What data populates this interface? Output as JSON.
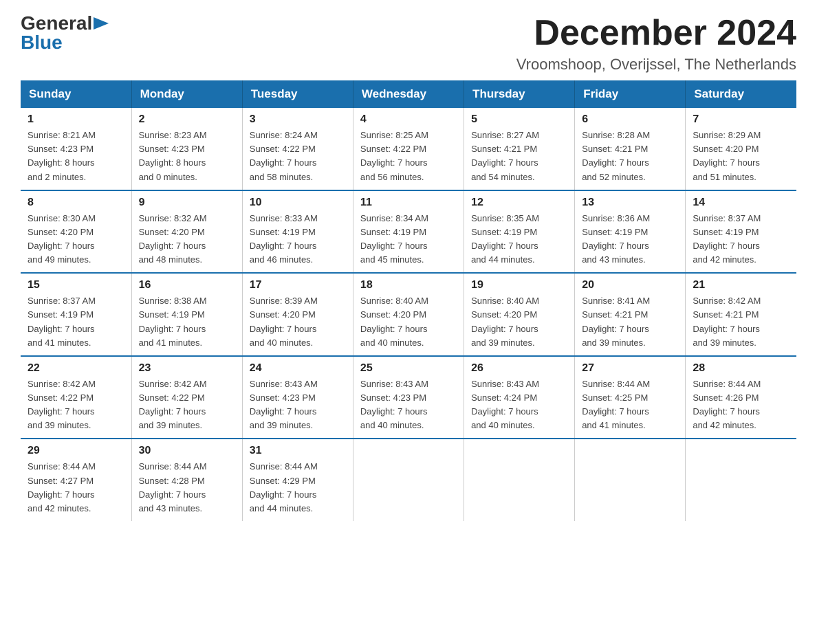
{
  "logo": {
    "general": "General",
    "blue": "Blue",
    "arrow": "▶"
  },
  "title": "December 2024",
  "location": "Vroomshoop, Overijssel, The Netherlands",
  "days_of_week": [
    "Sunday",
    "Monday",
    "Tuesday",
    "Wednesday",
    "Thursday",
    "Friday",
    "Saturday"
  ],
  "weeks": [
    [
      {
        "day": "1",
        "sunrise": "8:21 AM",
        "sunset": "4:23 PM",
        "daylight": "8 hours and 2 minutes."
      },
      {
        "day": "2",
        "sunrise": "8:23 AM",
        "sunset": "4:23 PM",
        "daylight": "8 hours and 0 minutes."
      },
      {
        "day": "3",
        "sunrise": "8:24 AM",
        "sunset": "4:22 PM",
        "daylight": "7 hours and 58 minutes."
      },
      {
        "day": "4",
        "sunrise": "8:25 AM",
        "sunset": "4:22 PM",
        "daylight": "7 hours and 56 minutes."
      },
      {
        "day": "5",
        "sunrise": "8:27 AM",
        "sunset": "4:21 PM",
        "daylight": "7 hours and 54 minutes."
      },
      {
        "day": "6",
        "sunrise": "8:28 AM",
        "sunset": "4:21 PM",
        "daylight": "7 hours and 52 minutes."
      },
      {
        "day": "7",
        "sunrise": "8:29 AM",
        "sunset": "4:20 PM",
        "daylight": "7 hours and 51 minutes."
      }
    ],
    [
      {
        "day": "8",
        "sunrise": "8:30 AM",
        "sunset": "4:20 PM",
        "daylight": "7 hours and 49 minutes."
      },
      {
        "day": "9",
        "sunrise": "8:32 AM",
        "sunset": "4:20 PM",
        "daylight": "7 hours and 48 minutes."
      },
      {
        "day": "10",
        "sunrise": "8:33 AM",
        "sunset": "4:19 PM",
        "daylight": "7 hours and 46 minutes."
      },
      {
        "day": "11",
        "sunrise": "8:34 AM",
        "sunset": "4:19 PM",
        "daylight": "7 hours and 45 minutes."
      },
      {
        "day": "12",
        "sunrise": "8:35 AM",
        "sunset": "4:19 PM",
        "daylight": "7 hours and 44 minutes."
      },
      {
        "day": "13",
        "sunrise": "8:36 AM",
        "sunset": "4:19 PM",
        "daylight": "7 hours and 43 minutes."
      },
      {
        "day": "14",
        "sunrise": "8:37 AM",
        "sunset": "4:19 PM",
        "daylight": "7 hours and 42 minutes."
      }
    ],
    [
      {
        "day": "15",
        "sunrise": "8:37 AM",
        "sunset": "4:19 PM",
        "daylight": "7 hours and 41 minutes."
      },
      {
        "day": "16",
        "sunrise": "8:38 AM",
        "sunset": "4:19 PM",
        "daylight": "7 hours and 41 minutes."
      },
      {
        "day": "17",
        "sunrise": "8:39 AM",
        "sunset": "4:20 PM",
        "daylight": "7 hours and 40 minutes."
      },
      {
        "day": "18",
        "sunrise": "8:40 AM",
        "sunset": "4:20 PM",
        "daylight": "7 hours and 40 minutes."
      },
      {
        "day": "19",
        "sunrise": "8:40 AM",
        "sunset": "4:20 PM",
        "daylight": "7 hours and 39 minutes."
      },
      {
        "day": "20",
        "sunrise": "8:41 AM",
        "sunset": "4:21 PM",
        "daylight": "7 hours and 39 minutes."
      },
      {
        "day": "21",
        "sunrise": "8:42 AM",
        "sunset": "4:21 PM",
        "daylight": "7 hours and 39 minutes."
      }
    ],
    [
      {
        "day": "22",
        "sunrise": "8:42 AM",
        "sunset": "4:22 PM",
        "daylight": "7 hours and 39 minutes."
      },
      {
        "day": "23",
        "sunrise": "8:42 AM",
        "sunset": "4:22 PM",
        "daylight": "7 hours and 39 minutes."
      },
      {
        "day": "24",
        "sunrise": "8:43 AM",
        "sunset": "4:23 PM",
        "daylight": "7 hours and 39 minutes."
      },
      {
        "day": "25",
        "sunrise": "8:43 AM",
        "sunset": "4:23 PM",
        "daylight": "7 hours and 40 minutes."
      },
      {
        "day": "26",
        "sunrise": "8:43 AM",
        "sunset": "4:24 PM",
        "daylight": "7 hours and 40 minutes."
      },
      {
        "day": "27",
        "sunrise": "8:44 AM",
        "sunset": "4:25 PM",
        "daylight": "7 hours and 41 minutes."
      },
      {
        "day": "28",
        "sunrise": "8:44 AM",
        "sunset": "4:26 PM",
        "daylight": "7 hours and 42 minutes."
      }
    ],
    [
      {
        "day": "29",
        "sunrise": "8:44 AM",
        "sunset": "4:27 PM",
        "daylight": "7 hours and 42 minutes."
      },
      {
        "day": "30",
        "sunrise": "8:44 AM",
        "sunset": "4:28 PM",
        "daylight": "7 hours and 43 minutes."
      },
      {
        "day": "31",
        "sunrise": "8:44 AM",
        "sunset": "4:29 PM",
        "daylight": "7 hours and 44 minutes."
      },
      null,
      null,
      null,
      null
    ]
  ]
}
